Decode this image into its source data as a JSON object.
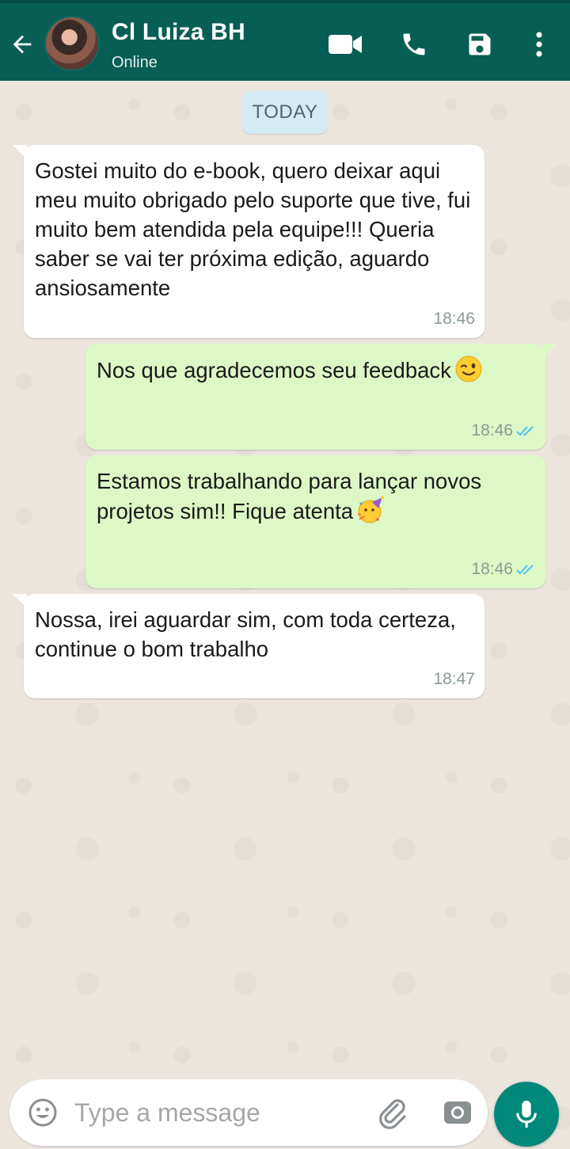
{
  "header": {
    "contact_name": "Cl Luiza BH",
    "status": "Online",
    "icons": [
      "back-arrow-icon",
      "video-icon",
      "phone-icon",
      "save-icon",
      "more-vert-icon"
    ]
  },
  "chat": {
    "date_label": "TODAY",
    "messages": [
      {
        "direction": "incoming",
        "text": "Gostei muito do e-book, quero deixar aqui meu muito obrigado pelo suporte que tive, fui muito bem atendida pela equipe!!! Queria saber se vai ter próxima edição, aguardo ansiosamente",
        "time": "18:46"
      },
      {
        "direction": "outgoing",
        "text": "Nos que agradecemos seu feedback",
        "emoji": "winking-face-emoji",
        "time": "18:46",
        "status": "read"
      },
      {
        "direction": "outgoing",
        "text": "Estamos trabalhando para lançar novos projetos sim!! Fique atenta",
        "emoji": "party-face-emoji",
        "time": "18:46",
        "status": "read"
      },
      {
        "direction": "incoming",
        "text": "Nossa, irei aguardar sim, com toda certeza, continue o bom trabalho",
        "time": "18:47"
      }
    ]
  },
  "composer": {
    "placeholder": "Type a message",
    "value": ""
  },
  "colors": {
    "header": "#075e54",
    "outgoing_bubble": "#dcf8c6",
    "incoming_bubble": "#ffffff",
    "read_ticks": "#4fc3f7",
    "fab": "#00897b"
  }
}
